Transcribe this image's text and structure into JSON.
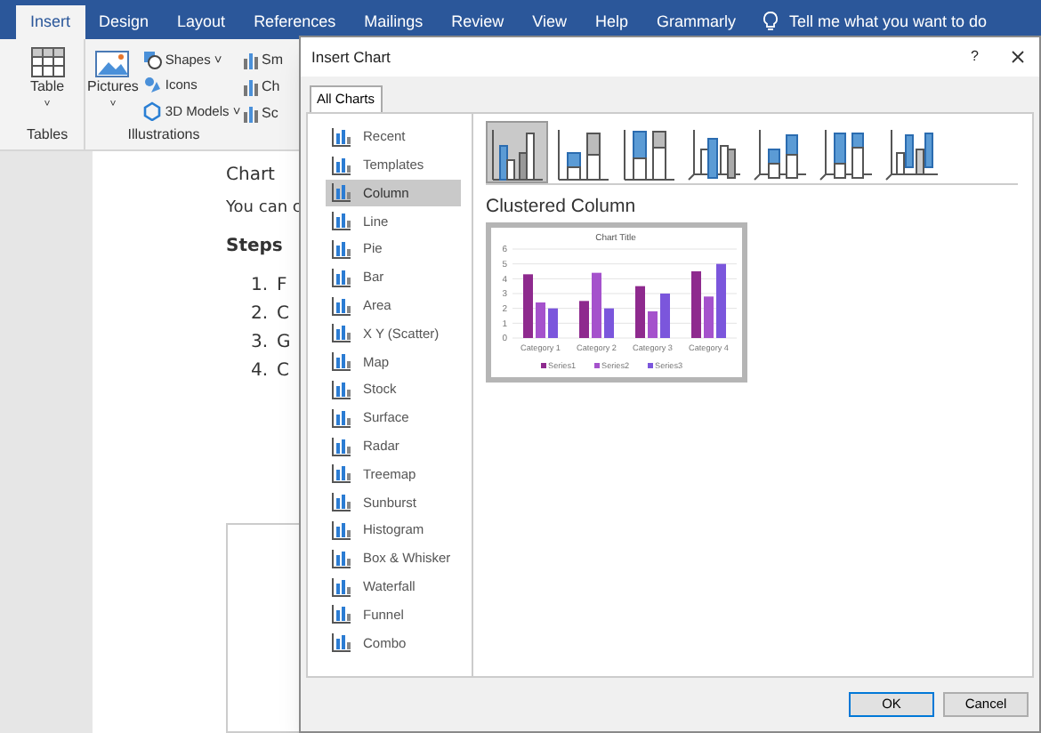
{
  "ribbon": {
    "tabs": [
      {
        "label": "Insert",
        "selected": true
      },
      {
        "label": "Design",
        "selected": false
      },
      {
        "label": "Layout",
        "selected": false
      },
      {
        "label": "References",
        "selected": false
      },
      {
        "label": "Mailings",
        "selected": false
      },
      {
        "label": "Review",
        "selected": false
      },
      {
        "label": "View",
        "selected": false
      },
      {
        "label": "Help",
        "selected": false
      },
      {
        "label": "Grammarly",
        "selected": false
      }
    ],
    "tell_me": "Tell me what you want to do",
    "table_button": {
      "label": "Table",
      "caret": "˅"
    },
    "tables_group": "Tables",
    "pictures_button": {
      "label": "Pictures",
      "caret": "˅"
    },
    "illustration_items": [
      {
        "label": "Shapes",
        "caret": "˅"
      },
      {
        "label": "Icons"
      },
      {
        "label": "3D Models",
        "caret": "˅"
      }
    ],
    "illustrations_group": "Illustrations",
    "more_items": [
      "Sm",
      "Ch",
      "Sc"
    ]
  },
  "document": {
    "heading": "Chart",
    "paragraph": "You can c",
    "subheading": "Steps",
    "steps": [
      {
        "number": "1.",
        "text": "F"
      },
      {
        "number": "2.",
        "text": "C"
      },
      {
        "number": "3.",
        "text": "G"
      },
      {
        "number": "4.",
        "text": "C"
      }
    ]
  },
  "dialog": {
    "title": "Insert Chart",
    "help": "?",
    "tabs": [
      {
        "label": "All Charts",
        "selected": true
      }
    ],
    "categories": [
      {
        "label": "Recent",
        "selected": false
      },
      {
        "label": "Templates",
        "selected": false
      },
      {
        "label": "Column",
        "selected": true
      },
      {
        "label": "Line",
        "selected": false
      },
      {
        "label": "Pie",
        "selected": false
      },
      {
        "label": "Bar",
        "selected": false
      },
      {
        "label": "Area",
        "selected": false
      },
      {
        "label": "X Y (Scatter)",
        "selected": false
      },
      {
        "label": "Map",
        "selected": false
      },
      {
        "label": "Stock",
        "selected": false
      },
      {
        "label": "Surface",
        "selected": false
      },
      {
        "label": "Radar",
        "selected": false
      },
      {
        "label": "Treemap",
        "selected": false
      },
      {
        "label": "Sunburst",
        "selected": false
      },
      {
        "label": "Histogram",
        "selected": false
      },
      {
        "label": "Box & Whisker",
        "selected": false
      },
      {
        "label": "Waterfall",
        "selected": false
      },
      {
        "label": "Funnel",
        "selected": false
      },
      {
        "label": "Combo",
        "selected": false
      }
    ],
    "subtypes": [
      {
        "kind": "clustered",
        "selected": true
      },
      {
        "kind": "stacked",
        "selected": false
      },
      {
        "kind": "full",
        "selected": false
      },
      {
        "kind": "clustered3d",
        "selected": false
      },
      {
        "kind": "stacked3d",
        "selected": false
      },
      {
        "kind": "full3d",
        "selected": false
      },
      {
        "kind": "column3d",
        "selected": false
      }
    ],
    "preview_title": "Clustered Column",
    "preview": {
      "chart_data": {
        "type": "bar",
        "title": "Chart Title",
        "categories": [
          "Category 1",
          "Category 2",
          "Category 3",
          "Category 4"
        ],
        "series": [
          {
            "name": "Series1",
            "color": "#8e2a8e",
            "values": [
              4.3,
              2.5,
              3.5,
              4.5
            ]
          },
          {
            "name": "Series2",
            "color": "#a552cc",
            "values": [
              2.4,
              4.4,
              1.8,
              2.8
            ]
          },
          {
            "name": "Series3",
            "color": "#7b56dc",
            "values": [
              2,
              2,
              3,
              5
            ]
          }
        ],
        "ylim": [
          0,
          6
        ],
        "yticks": [
          0,
          1,
          2,
          3,
          4,
          5,
          6
        ],
        "grid": true,
        "legend": true
      }
    },
    "buttons": [
      {
        "label": "OK",
        "default": true
      },
      {
        "label": "Cancel",
        "default": false
      }
    ]
  }
}
